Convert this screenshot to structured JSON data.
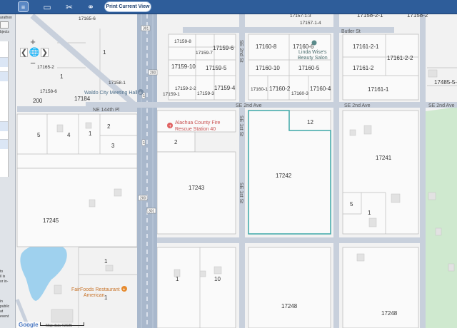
{
  "toolbar": {
    "menu_icon": "menu-icon",
    "icons": [
      "comment-icon",
      "eraser-icon",
      "link-icon"
    ],
    "print_label": "Print Current View"
  },
  "left_panel": {
    "text_top": "arathon",
    "text_objects": "bjects",
    "text_lines": [
      "to",
      "il is",
      "or in-",
      "",
      "in",
      "public",
      "at",
      "event"
    ]
  },
  "map": {
    "roads": {
      "se_2nd_ave_a": "SE 2nd Ave",
      "se_2nd_ave_b": "SE 2nd Ave",
      "se_2nd_ave_c": "SE 2nd Ave",
      "ne_1st_ave": "NE 144th Pl",
      "se_1st_st_a": "SE 1st St",
      "se_1st_st_b": "SE 1st St",
      "se_2nd_st_vert": "SE 2nd St",
      "butler_st": "Butler St",
      "shield_301_a": "301",
      "shield_200_a": "200",
      "shield_200_b": "200",
      "shield_301_b": "301",
      "shield_1_a": "1",
      "shield_1_b": "1"
    },
    "parcels": {
      "p17157_1_3": "17157-1-3",
      "p17157_1_4": "17157-1-4",
      "p17158_2_1": "17158-2-1",
      "p17158_2_top": "17158-2",
      "p17159_8": "17159-8",
      "p17159_7": "17159-7",
      "p17159_6": "17159-6",
      "p17159_10": "17159-10",
      "p17159_5": "17159-5",
      "p17159_2_2": "17159-2-2",
      "p17159_3": "17159-3",
      "p17159_4": "17159-4",
      "p17159_1": "17159-1",
      "p17160_8": "17160-8",
      "p17160_6": "17160-6",
      "p17160_10": "17160-10",
      "p17160_5": "17160-5",
      "p17160_1": "17160-1",
      "p17160_2": "17160-2",
      "p17160_3": "17160-3",
      "p17160_4": "17160-4",
      "p17161_2_1": "17161-2-1",
      "p17161_2_2": "17161-2-2",
      "p17161_2": "17161-2",
      "p17161_1": "17161-1",
      "p17485_5": "17485-5-",
      "p17184": "17184",
      "p17241": "17241",
      "p17242": "17242",
      "p17243": "17243",
      "p17245": "17245",
      "p17248_a": "17248",
      "p17248_b": "17248",
      "n1_a": "1",
      "n1_b": "1",
      "n1_c": "1",
      "n1_d": "1",
      "n1_e": "1",
      "n1_f": "1",
      "n1_g": "1",
      "n2_a": "2",
      "n2_b": "2",
      "n3": "3",
      "n4": "4",
      "n5_a": "5",
      "n5_b": "5",
      "n10": "10",
      "n12": "12",
      "n200": "200",
      "n17165_6": "17165-6",
      "n17165_2": "17165-2",
      "n17158_6": "17158-6",
      "n17158_1": "17158-1"
    },
    "pois": {
      "meeting_hall": "Waldo City Meeting Hall",
      "fire_station_line1": "Alachua County Fire",
      "fire_station_line2": "Rescue Station 40",
      "beauty_salon_line1": "Linda Wise's",
      "beauty_salon_line2": "Beauty Salon",
      "restaurant_name": "FairFoods Restaurant",
      "restaurant_type": "American"
    },
    "colors": {
      "highlight": "#3ca7a7",
      "water": "#9fd1ee",
      "park": "#cfe9cf",
      "road_main": "#a9b8cc",
      "road_minor": "#c8d0dc",
      "fire_icon": "#e06060",
      "restaurant_icon": "#e68a2e"
    }
  },
  "controls": {
    "zoom_in": "+",
    "zoom_out": "−",
    "pan_left": "❮",
    "pan_right": "❯",
    "globe": "🌐"
  },
  "attribution": {
    "google": "Google",
    "scale": "Map data ©2025"
  }
}
